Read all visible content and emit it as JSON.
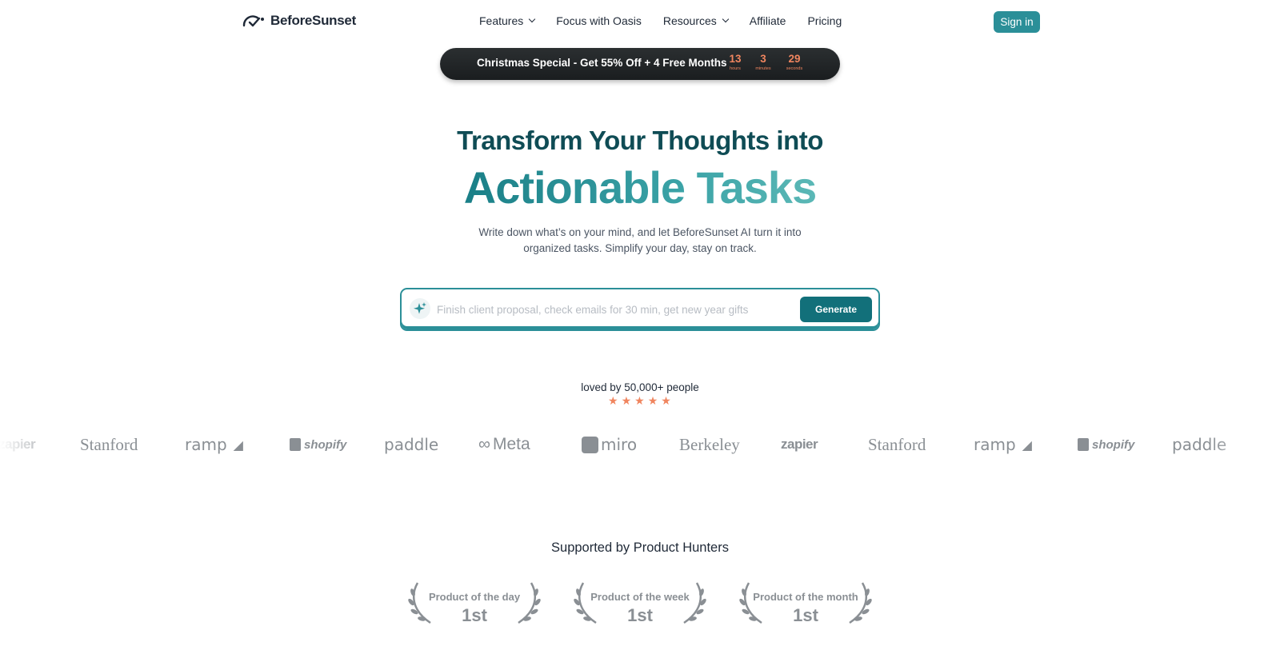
{
  "brand": {
    "name": "BeforeSunset"
  },
  "nav": {
    "items": [
      {
        "label": "Features",
        "dropdown": true
      },
      {
        "label": "Focus with Oasis",
        "dropdown": false
      },
      {
        "label": "Resources",
        "dropdown": true
      },
      {
        "label": "Affiliate",
        "dropdown": false
      },
      {
        "label": "Pricing",
        "dropdown": false
      }
    ],
    "signin_label": "Sign in"
  },
  "promo": {
    "text": "Christmas Special - Get 55% Off + 4 Free Months",
    "countdown": [
      {
        "value": "13",
        "unit": "hours"
      },
      {
        "value": "3",
        "unit": "minutes"
      },
      {
        "value": "29",
        "unit": "seconds"
      }
    ]
  },
  "hero": {
    "title_line1": "Transform Your Thoughts into",
    "title_line2": "Actionable Tasks",
    "subtitle_line1": "Write down what’s on your mind, and let BeforeSunset AI turn it into",
    "subtitle_line2": "organized tasks. Simplify your day, stay on track."
  },
  "task_input": {
    "value": "",
    "placeholder": "Finish client proposal, check emails for 30 min, get new year gifts",
    "button_label": "Generate"
  },
  "social_proof": {
    "text": "loved by 50,000+ people",
    "rating_stars": 5
  },
  "logos": [
    "zapier",
    "Stanford",
    "ramp",
    "shopify",
    "paddle",
    "Meta",
    "miro",
    "Berkeley",
    "zapier",
    "Stanford",
    "ramp",
    "shopify",
    "paddle"
  ],
  "product_hunt": {
    "title": "Supported by Product Hunters",
    "awards": [
      {
        "label": "Product of the day",
        "rank": "1st"
      },
      {
        "label": "Product of the week",
        "rank": "1st"
      },
      {
        "label": "Product of the month",
        "rank": "1st"
      }
    ]
  },
  "colors": {
    "accent": "#2b8f98",
    "button_dark": "#12707a",
    "heading": "#0f4c55",
    "countdown": "#f0855f",
    "star": "#f0855f",
    "logo_gray": "#8a8f94"
  }
}
